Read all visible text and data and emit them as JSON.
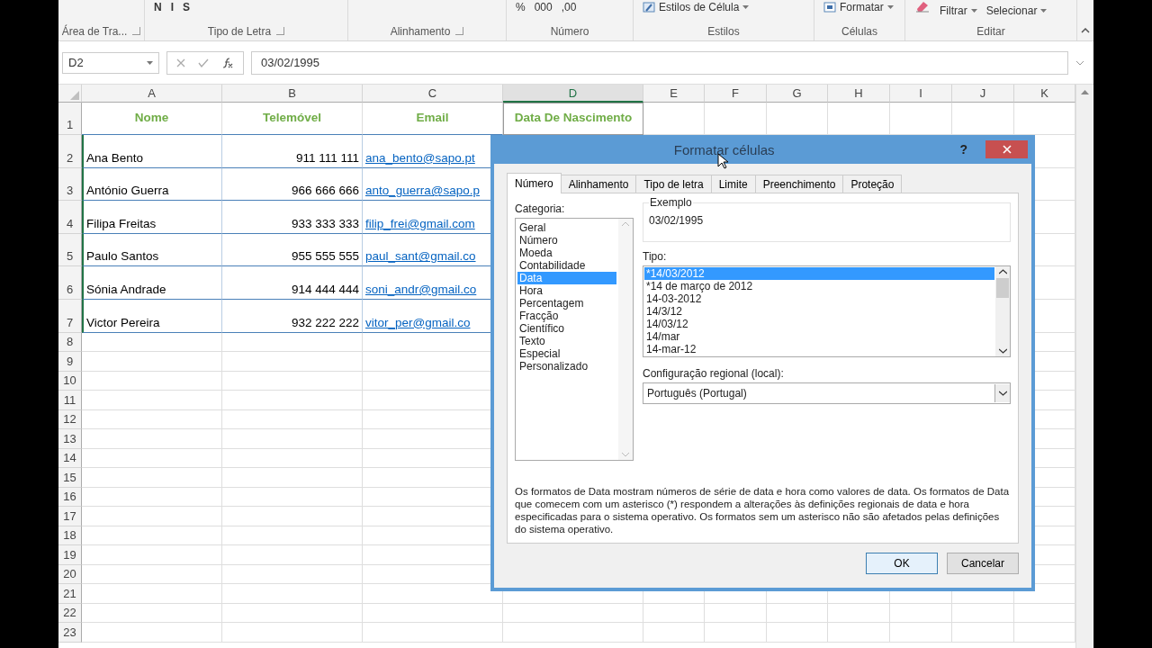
{
  "ribbon": {
    "font_buttons": [
      "N",
      "I",
      "S"
    ],
    "number_buttons": [
      "%",
      "000",
      ",00"
    ],
    "groups": [
      "Área de Tra...",
      "Tipo de Letra",
      "Alinhamento",
      "Número",
      "Estilos",
      "Células",
      "Editar"
    ],
    "style_button": "Estilos de Célula",
    "cells_button": "Formatar",
    "edit_buttons": [
      "Filtrar",
      "Selecionar"
    ]
  },
  "formula_bar": {
    "name_box": "D2",
    "value": "03/02/1995"
  },
  "sheet": {
    "columns": [
      {
        "label": "A",
        "selected": false
      },
      {
        "label": "B",
        "selected": false
      },
      {
        "label": "C",
        "selected": false
      },
      {
        "label": "D",
        "selected": true
      },
      {
        "label": "E",
        "selected": false
      },
      {
        "label": "F",
        "selected": false
      },
      {
        "label": "G",
        "selected": false
      },
      {
        "label": "H",
        "selected": false
      },
      {
        "label": "I",
        "selected": false
      },
      {
        "label": "J",
        "selected": false
      },
      {
        "label": "K",
        "selected": false
      }
    ],
    "headers": [
      "Nome",
      "Telemóvel",
      "Email",
      "Data De Nascimento"
    ],
    "rows": [
      {
        "name": "Ana Bento",
        "phone": "911 111 111",
        "email": "ana_bento@sapo.pt"
      },
      {
        "name": "António Guerra",
        "phone": "966 666 666",
        "email": "anto_guerra@sapo.p"
      },
      {
        "name": "Filipa Freitas",
        "phone": "933 333 333",
        "email": "filip_frei@gmail.com"
      },
      {
        "name": "Paulo Santos",
        "phone": "955 555 555",
        "email": "paul_sant@gmail.co"
      },
      {
        "name": "Sónia Andrade",
        "phone": "914 444 444",
        "email": "soni_andr@gmail.co"
      },
      {
        "name": "Victor Pereira",
        "phone": "932 222 222",
        "email": "vitor_per@gmail.co"
      }
    ],
    "row_numbers": [
      "1",
      "2",
      "3",
      "4",
      "5",
      "6",
      "7",
      "8",
      "9",
      "10",
      "11",
      "12",
      "13",
      "14",
      "15",
      "16",
      "17",
      "18",
      "19",
      "20",
      "21",
      "22",
      "23"
    ]
  },
  "dialog": {
    "title": "Formatar células",
    "help": "?",
    "tabs": [
      {
        "label": "Número",
        "selected": true
      },
      {
        "label": "Alinhamento",
        "selected": false
      },
      {
        "label": "Tipo de letra",
        "selected": false
      },
      {
        "label": "Limite",
        "selected": false
      },
      {
        "label": "Preenchimento",
        "selected": false
      },
      {
        "label": "Proteção",
        "selected": false
      }
    ],
    "category_label": "Categoria:",
    "categories": [
      {
        "label": "Geral",
        "selected": false
      },
      {
        "label": "Número",
        "selected": false
      },
      {
        "label": "Moeda",
        "selected": false
      },
      {
        "label": "Contabilidade",
        "selected": false
      },
      {
        "label": "Data",
        "selected": true
      },
      {
        "label": "Hora",
        "selected": false
      },
      {
        "label": "Percentagem",
        "selected": false
      },
      {
        "label": "Fracção",
        "selected": false
      },
      {
        "label": "Científico",
        "selected": false
      },
      {
        "label": "Texto",
        "selected": false
      },
      {
        "label": "Especial",
        "selected": false
      },
      {
        "label": "Personalizado",
        "selected": false
      }
    ],
    "sample_label": "Exemplo",
    "sample_value": "03/02/1995",
    "type_label": "Tipo:",
    "types": [
      {
        "label": "*14/03/2012",
        "selected": true
      },
      {
        "label": "*14 de março de 2012",
        "selected": false
      },
      {
        "label": "14-03-2012",
        "selected": false
      },
      {
        "label": "14/3/12",
        "selected": false
      },
      {
        "label": "14/03/12",
        "selected": false
      },
      {
        "label": "14/mar",
        "selected": false
      },
      {
        "label": "14-mar-12",
        "selected": false
      }
    ],
    "locale_label": "Configuração regional (local):",
    "locale_value": "Português (Portugal)",
    "description": "Os formatos de Data mostram números de série de data e hora como valores de data. Os formatos de Data que comecem com um asterisco (*) respondem a alterações às definições regionais de data e hora especificadas para o sistema operativo. Os formatos sem um asterisco não são afetados pelas definições do sistema operativo.",
    "buttons": [
      "OK",
      "Cancelar"
    ]
  }
}
